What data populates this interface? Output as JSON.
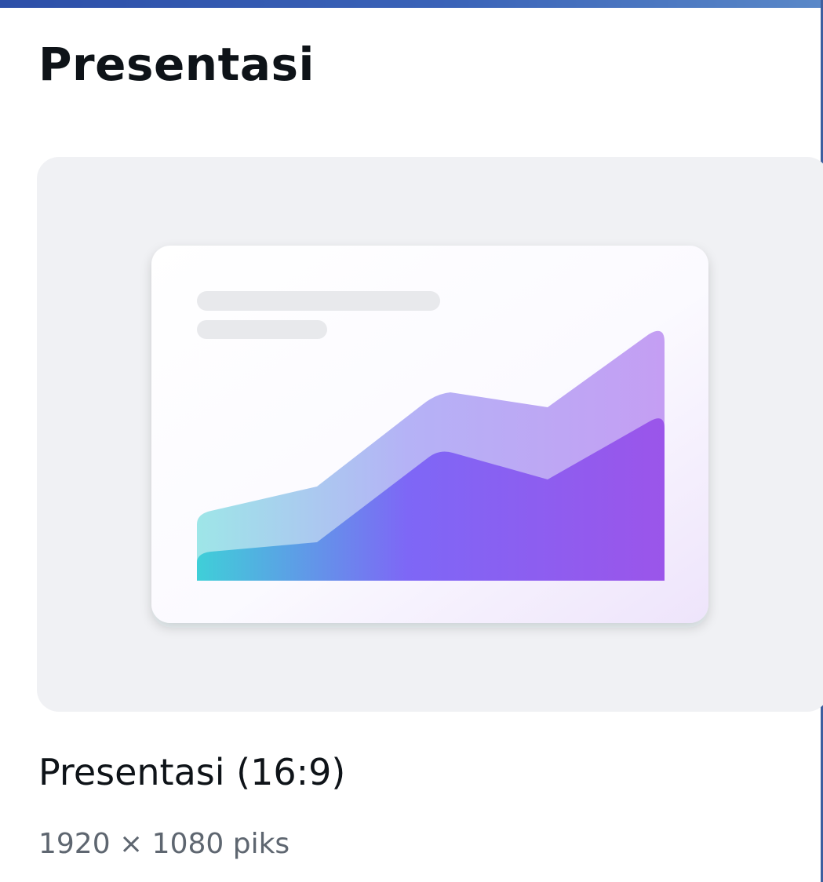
{
  "section": {
    "title": "Presentasi"
  },
  "design_option": {
    "name": "Presentasi (16:9)",
    "dimensions": "1920 × 1080 piks"
  },
  "thumbnail": {
    "icon": "area-chart-slide-icon",
    "colors": {
      "card_background": "#f0f1f4",
      "slide_background": "#ffffff",
      "text_placeholder": "#e8e9ec",
      "back_area_start": "#9ee6e8",
      "back_area_end": "#c49ef3",
      "front_area_start": "#3fcfd8",
      "front_area_end": "#9b55ea"
    }
  },
  "colors": {
    "top_bar": "#3a63b8",
    "title_text": "#0e1318",
    "secondary_text": "#5e6670"
  }
}
